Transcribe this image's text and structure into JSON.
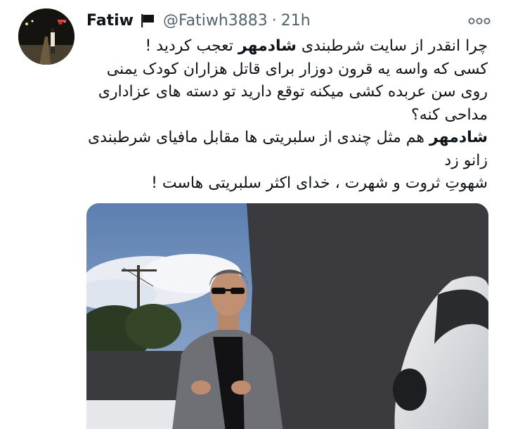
{
  "tweet": {
    "author": {
      "display_name": "Fatiw",
      "handle": "@Fatiwh3883",
      "flag_icon": "black-flag-icon"
    },
    "separator": "·",
    "timestamp": "21h",
    "more_icon": "more-options-icon",
    "body": {
      "para1": {
        "pre": "چرا انقدر از سایت شرطبندی ",
        "bold": "شادمهر",
        "post": " تعجب کردید !"
      },
      "para2": "کسی که واسه یه قرون دوزار برای قاتل هزاران کودک یمنی روی سن عربده کشی میکنه توقع دارید تو دسته های عزاداری مداحی کنه؟",
      "para3": {
        "bold": "شادمهر",
        "post": " هم مثل چندی از سلبریتی ها مقابل مافیای شرطبندی زانو زد"
      },
      "para4": "شهوتِ ثروت و شهرت ، خدای اکثر سلبریتی هاست !"
    },
    "media": {
      "type": "video-thumbnail",
      "subject": "man-in-sunglasses-and-gray-suit-beside-white-car"
    }
  }
}
